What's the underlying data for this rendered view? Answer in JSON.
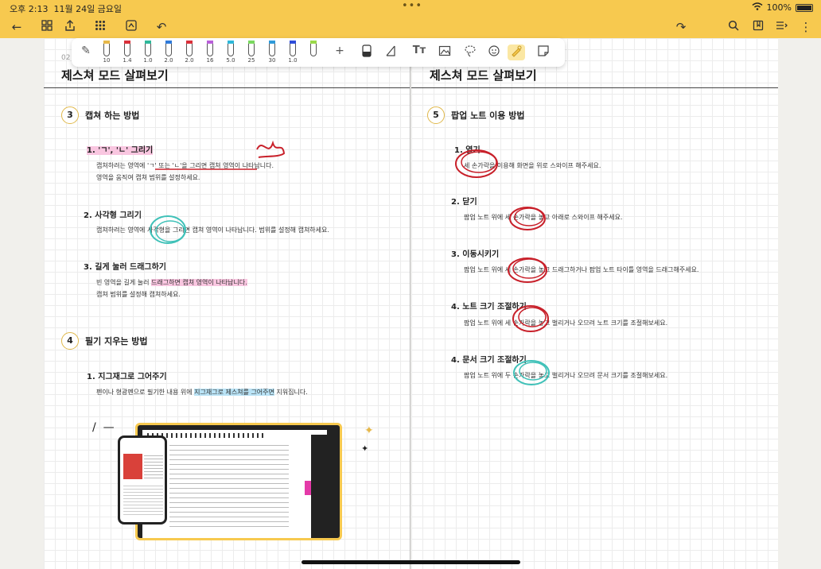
{
  "status": {
    "time": "오후 2:13",
    "date": "11월 24일 금요일",
    "battery": "100%"
  },
  "toolbar": {
    "pens": [
      {
        "size": "10",
        "color": "#e6b84a"
      },
      {
        "size": "1.4",
        "color": "#d9303a"
      },
      {
        "size": "1.0",
        "color": "#2fb89a"
      },
      {
        "size": "2.0",
        "color": "#2f7ad9"
      },
      {
        "size": "2.0",
        "color": "#d9303a"
      },
      {
        "size": "16",
        "color": "#b95fd9"
      },
      {
        "size": "5.0",
        "color": "#2fb8d9"
      },
      {
        "size": "25",
        "color": "#7ad95f"
      },
      {
        "size": "30",
        "color": "#2f9ad9"
      },
      {
        "size": "1.0",
        "color": "#2f4ed9"
      },
      {
        "size": "",
        "color": "#9ad94a"
      }
    ],
    "text_tool": "Tт"
  },
  "left_page": {
    "number": "02",
    "title": "제스쳐 모드 살펴보기",
    "section3": {
      "num": "3",
      "title": "캡쳐 하는 방법",
      "item1": {
        "title": "1. 'ㄱ', 'ㄴ' 그리기",
        "line1": "캡쳐하려는 영역에 'ㄱ' 또는 'ㄴ'을 그리면 캡쳐 영역이 나타납니다.",
        "line2": "영역을 움직여 캡쳐 범위를 설정하세요."
      },
      "item2": {
        "title": "2. 사각형 그리기",
        "line1": "캡쳐하려는 영역에 사각형을 그리면 캡쳐 영역이 나타납니다. 범위를 설정해 캡쳐하세요."
      },
      "item3": {
        "title": "3. 길게 눌러 드래그하기",
        "line1_a": "빈 영역을 길게 눌러 ",
        "line1_b": "드래그하면 캡쳐 영역이 나타납니다.",
        "line2": "캡쳐 범위를 설정해 캡쳐하세요."
      }
    },
    "section4": {
      "num": "4",
      "title": "필기 지우는 방법",
      "item1": {
        "title": "1. 지그재그로 그어주기",
        "line1_a": "펜이나 형광펜으로 필기한 내용 위에 ",
        "line1_b": "지그재그로 제스쳐를 그어주면",
        "line1_c": " 지워집니다."
      }
    }
  },
  "right_page": {
    "title": "제스쳐 모드 살펴보기",
    "section5": {
      "num": "5",
      "title": "팝업 노트 이용 방법",
      "items": [
        {
          "title": "1. 열기",
          "line": "세 손가락을 이용해 화면을 위로 스와이프 해주세요."
        },
        {
          "title": "2. 닫기",
          "line": "팝업 노트 위에 세 손가락을 놓고 아래로 스와이프 해주세요."
        },
        {
          "title": "3. 이동시키기",
          "line": "팝업 노트 위에 세 손가락을 놓고 드래그하거나 팝업 노트 타이틀 영역을 드래그해주세요."
        },
        {
          "title": "4. 노트 크기 조절하기",
          "line": "팝업 노트 위에 세 손가락을 놓고 벌리거나 오므려 노트 크기를 조절해보세요."
        },
        {
          "title": "4. 문서 크기 조절하기",
          "line": "팝업 노트 위에 두 손가락을 놓고 벌리거나 오므려 문서 크기를 조절해보세요."
        }
      ]
    }
  },
  "colors": {
    "accent": "#f7c94f",
    "ink_red": "#c8202a",
    "ink_teal": "#3fc1b8"
  }
}
